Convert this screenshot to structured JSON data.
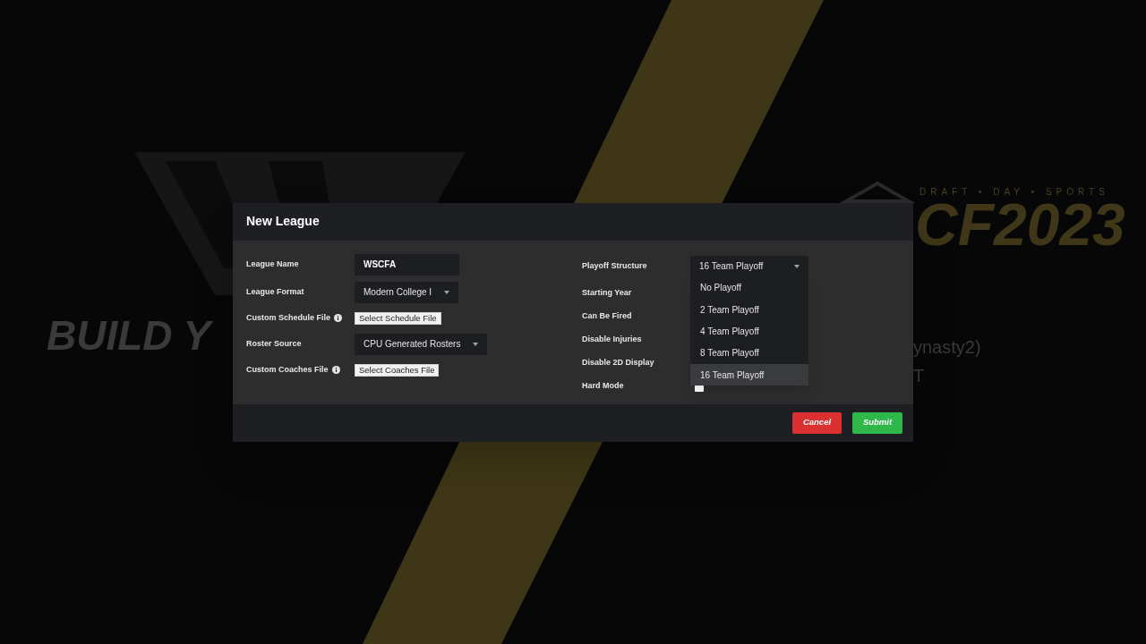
{
  "background": {
    "brand": "DRAFT • DAY • SPORTS",
    "logo": "CF2023",
    "headline": "BUILD Y",
    "lines": [
      "ynasty2)",
      "T"
    ]
  },
  "dialog": {
    "title": "New League",
    "left_fields": [
      {
        "kind": "text",
        "label": "League Name",
        "value": "WSCFA"
      },
      {
        "kind": "select",
        "label": "League Format",
        "value": "Modern College I"
      },
      {
        "kind": "file",
        "label": "Custom Schedule File",
        "info": true,
        "button": "Select Schedule File"
      },
      {
        "kind": "select",
        "label": "Roster Source",
        "value": "CPU Generated Rosters"
      },
      {
        "kind": "file",
        "label": "Custom Coaches File",
        "info": true,
        "button": "Select Coaches File"
      }
    ],
    "right_fields": [
      {
        "kind": "select",
        "label": "Playoff Structure",
        "value": "16 Team Playoff",
        "expanded": true,
        "options": [
          {
            "label": "No Playoff",
            "selected": false
          },
          {
            "label": "2 Team Playoff",
            "selected": false
          },
          {
            "label": "4 Team Playoff",
            "selected": false
          },
          {
            "label": "8 Team Playoff",
            "selected": false
          },
          {
            "label": "16 Team Playoff",
            "selected": true
          }
        ]
      },
      {
        "kind": "covered",
        "label": "Starting Year"
      },
      {
        "kind": "covered",
        "label": "Can Be Fired"
      },
      {
        "kind": "covered",
        "label": "Disable Injuries"
      },
      {
        "kind": "covered",
        "label": "Disable 2D Display"
      },
      {
        "kind": "checkbox",
        "label": "Hard Mode",
        "checked": false
      }
    ],
    "buttons": [
      {
        "kind": "cancel",
        "label": "Cancel"
      },
      {
        "kind": "submit",
        "label": "Submit"
      }
    ]
  }
}
